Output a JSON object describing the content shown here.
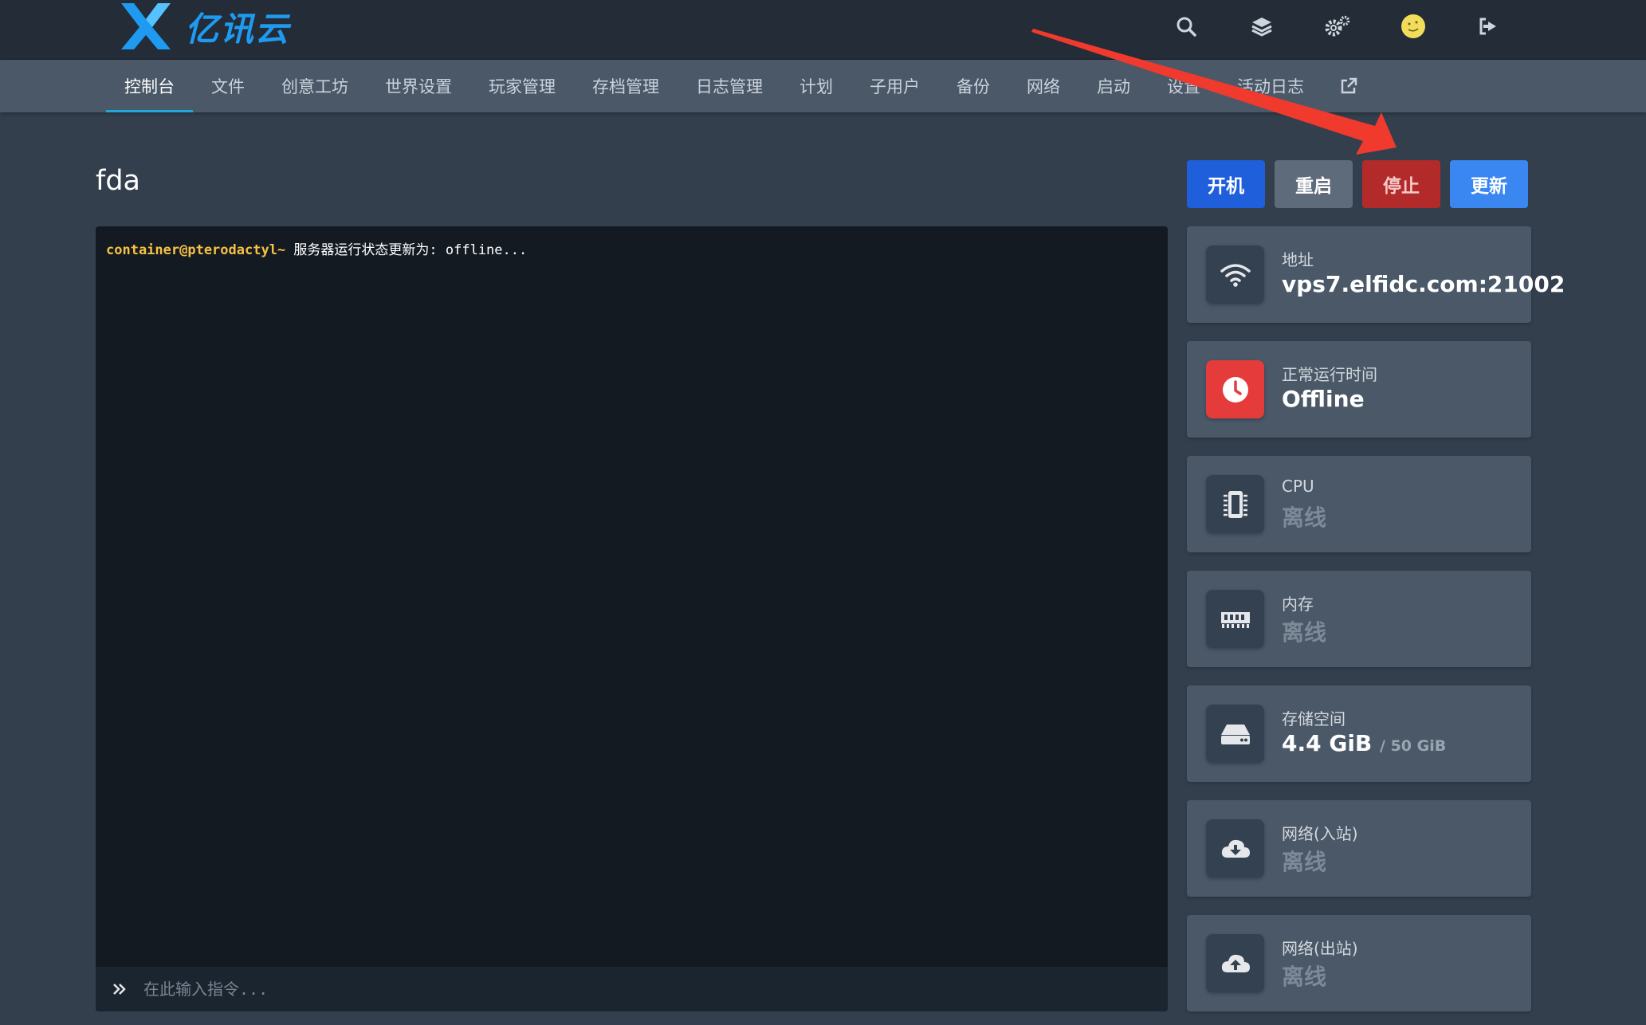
{
  "brand": {
    "name": "亿讯云"
  },
  "topbar": {
    "icons": [
      "search-icon",
      "layers-icon",
      "cogs-icon",
      "avatar",
      "logout-icon"
    ]
  },
  "nav": {
    "items": [
      "控制台",
      "文件",
      "创意工坊",
      "世界设置",
      "玩家管理",
      "存档管理",
      "日志管理",
      "计划",
      "子用户",
      "备份",
      "网络",
      "启动",
      "设置",
      "活动日志"
    ],
    "active": "控制台"
  },
  "server": {
    "name": "fda"
  },
  "actions": {
    "start": "开机",
    "restart": "重启",
    "stop": "停止",
    "update": "更新"
  },
  "console": {
    "prompt": "container@pterodactyl~",
    "message": " 服务器运行状态更新为: offline...",
    "input_placeholder": "在此输入指令..."
  },
  "stats": [
    {
      "icon": "wifi-icon",
      "label": "地址",
      "value": "vps7.elfidc.com:21002"
    },
    {
      "icon": "clock-icon",
      "label": "正常运行时间",
      "value": "Offline",
      "accent": "#e53b3b"
    },
    {
      "icon": "microchip-icon",
      "label": "CPU",
      "value": "离线"
    },
    {
      "icon": "memory-icon",
      "label": "内存",
      "value": "离线"
    },
    {
      "icon": "hdd-icon",
      "label": "存储空间",
      "value": "4.4 GiB",
      "sub": "/ 50 GiB"
    },
    {
      "icon": "cloud-download-icon",
      "label": "网络(入站)",
      "value": "离线"
    },
    {
      "icon": "cloud-upload-icon",
      "label": "网络(出站)",
      "value": "离线"
    }
  ],
  "colors": {
    "topbar": "#232c37",
    "subnav": "#4a5868",
    "page": "#333f4d",
    "console": "#141a22",
    "start": "#1f5fdb",
    "restart": "#5e6b7a",
    "stop": "#b32a2a",
    "update": "#3a87f2",
    "arrow": "#f03a2e"
  }
}
